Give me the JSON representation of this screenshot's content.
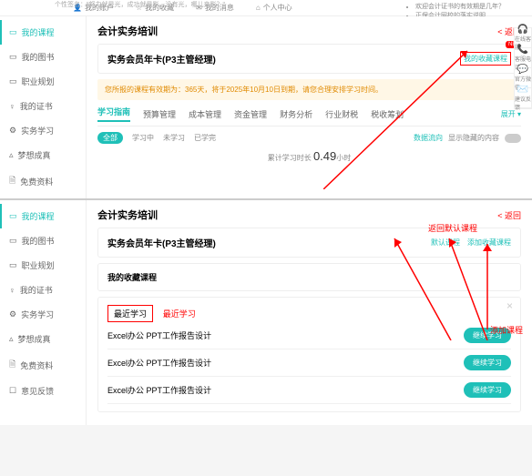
{
  "topbar": {
    "signature": "个性签名：\"努力就是光，成功就是影。没有光，哪儿来影？\"",
    "nav": [
      "我的账户",
      "我的收藏",
      "我的消息",
      "个人中心"
    ]
  },
  "topNotice": [
    "欢迎会计证书的有效期是几年？",
    "正保会计网校的落实说明"
  ],
  "floatIcons": [
    {
      "icon": "🎧",
      "label": "在线客服"
    },
    {
      "icon": "📞",
      "label": "客服电话"
    },
    {
      "icon": "💬",
      "label": "官方微信"
    },
    {
      "icon": "✉️",
      "label": "建议反馈"
    }
  ],
  "sidebar1": [
    "我的课程",
    "我的图书",
    "职业规划",
    "我的证书",
    "实务学习",
    "梦想成真",
    "免费资料"
  ],
  "main1": {
    "title": "会计实务培训",
    "back": "< 返回",
    "member": "实务会员年卡(P3主管经理)",
    "favLink": "我的收藏课程",
    "newBadge": "NEW",
    "notice": "您所报的课程有效期为：365天，将于2025年10月10日到期，请您合理安排学习时间。",
    "tabs": [
      "学习指南",
      "预算管理",
      "成本管理",
      "资金管理",
      "财务分析",
      "行业财税",
      "税收筹划"
    ],
    "expand": "展开 ▾",
    "filters": {
      "chip": "全部",
      "items": [
        "学习中",
        "未学习",
        "已学完"
      ],
      "statLink": "数据流向",
      "hideLabel": "显示隐藏的内容"
    },
    "studyTime": {
      "label": "累计学习时长",
      "value": "0.49",
      "unit": "小时"
    }
  },
  "sidebar2": [
    "我的课程",
    "我的图书",
    "职业规划",
    "我的证书",
    "实务学习",
    "梦想成真",
    "免费资料",
    "意见反馈"
  ],
  "main2": {
    "title": "会计实务培训",
    "back": "< 返回",
    "member": "实务会员年卡(P3主管经理)",
    "links": [
      "默认课程",
      "添加收藏课程"
    ],
    "favTitle": "我的收藏课程",
    "recent": "最近学习",
    "recentLabel": "最近学习",
    "courses": [
      "Excel办公 PPT工作报告设计",
      "Excel办公 PPT工作报告设计",
      "Excel办公 PPT工作报告设计"
    ],
    "btn": "继续学习"
  },
  "annotations": {
    "returnDefault": "返回默认课程",
    "addCourse": "添加课程"
  }
}
